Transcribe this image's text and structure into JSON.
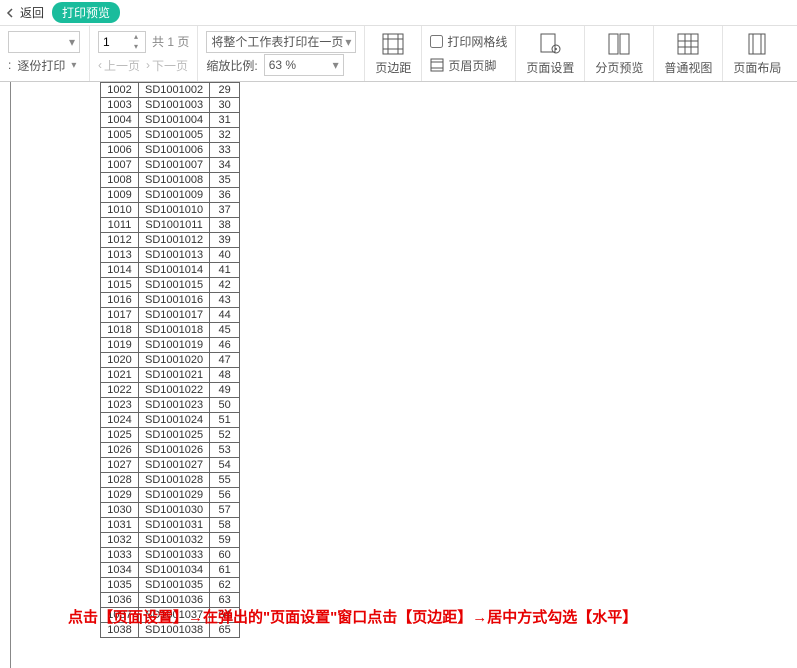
{
  "header": {
    "back": "返回",
    "title": "打印预览"
  },
  "toolbar": {
    "printMode": "逐份打印",
    "pageNum": "1",
    "totalPages": "共 1 页",
    "prevPage": "上一页",
    "nextPage": "下一页",
    "fitSelect": "将整个工作表打印在一页",
    "zoomLabel": "缩放比例:",
    "zoomValue": "63 %",
    "margins": "页边距",
    "gridlines": "打印网格线",
    "headerFooter": "页眉页脚",
    "pageSetup": "页面设置",
    "pageBreakPreview": "分页预览",
    "normalView": "普通视图",
    "pageLayout": "页面布局"
  },
  "rows": [
    {
      "a": "1002",
      "b": "SD1001002",
      "c": "29"
    },
    {
      "a": "1003",
      "b": "SD1001003",
      "c": "30"
    },
    {
      "a": "1004",
      "b": "SD1001004",
      "c": "31"
    },
    {
      "a": "1005",
      "b": "SD1001005",
      "c": "32"
    },
    {
      "a": "1006",
      "b": "SD1001006",
      "c": "33"
    },
    {
      "a": "1007",
      "b": "SD1001007",
      "c": "34"
    },
    {
      "a": "1008",
      "b": "SD1001008",
      "c": "35"
    },
    {
      "a": "1009",
      "b": "SD1001009",
      "c": "36"
    },
    {
      "a": "1010",
      "b": "SD1001010",
      "c": "37"
    },
    {
      "a": "1011",
      "b": "SD1001011",
      "c": "38"
    },
    {
      "a": "1012",
      "b": "SD1001012",
      "c": "39"
    },
    {
      "a": "1013",
      "b": "SD1001013",
      "c": "40"
    },
    {
      "a": "1014",
      "b": "SD1001014",
      "c": "41"
    },
    {
      "a": "1015",
      "b": "SD1001015",
      "c": "42"
    },
    {
      "a": "1016",
      "b": "SD1001016",
      "c": "43"
    },
    {
      "a": "1017",
      "b": "SD1001017",
      "c": "44"
    },
    {
      "a": "1018",
      "b": "SD1001018",
      "c": "45"
    },
    {
      "a": "1019",
      "b": "SD1001019",
      "c": "46"
    },
    {
      "a": "1020",
      "b": "SD1001020",
      "c": "47"
    },
    {
      "a": "1021",
      "b": "SD1001021",
      "c": "48"
    },
    {
      "a": "1022",
      "b": "SD1001022",
      "c": "49"
    },
    {
      "a": "1023",
      "b": "SD1001023",
      "c": "50"
    },
    {
      "a": "1024",
      "b": "SD1001024",
      "c": "51"
    },
    {
      "a": "1025",
      "b": "SD1001025",
      "c": "52"
    },
    {
      "a": "1026",
      "b": "SD1001026",
      "c": "53"
    },
    {
      "a": "1027",
      "b": "SD1001027",
      "c": "54"
    },
    {
      "a": "1028",
      "b": "SD1001028",
      "c": "55"
    },
    {
      "a": "1029",
      "b": "SD1001029",
      "c": "56"
    },
    {
      "a": "1030",
      "b": "SD1001030",
      "c": "57"
    },
    {
      "a": "1031",
      "b": "SD1001031",
      "c": "58"
    },
    {
      "a": "1032",
      "b": "SD1001032",
      "c": "59"
    },
    {
      "a": "1033",
      "b": "SD1001033",
      "c": "60"
    },
    {
      "a": "1034",
      "b": "SD1001034",
      "c": "61"
    },
    {
      "a": "1035",
      "b": "SD1001035",
      "c": "62"
    },
    {
      "a": "1036",
      "b": "SD1001036",
      "c": "63"
    },
    {
      "a": "1037",
      "b": "SD1001037",
      "c": "64"
    },
    {
      "a": "1038",
      "b": "SD1001038",
      "c": "65"
    }
  ],
  "annotation": "点击【页面设置】→在弹出的\"页面设置\"窗口点击【页边距】→居中方式勾选【水平】"
}
